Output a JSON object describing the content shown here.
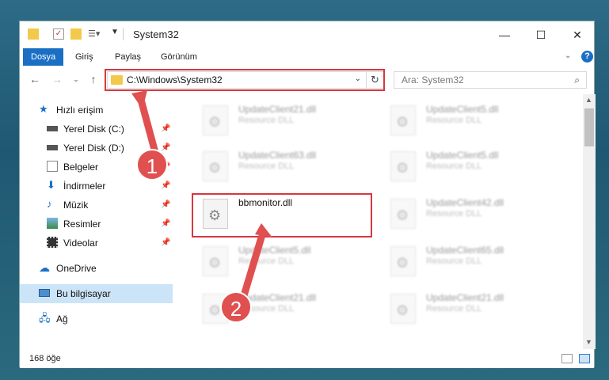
{
  "window": {
    "title": "System32"
  },
  "ribbon": {
    "tabs": [
      "Dosya",
      "Giriş",
      "Paylaş",
      "Görünüm"
    ]
  },
  "address": {
    "path": "C:\\Windows\\System32"
  },
  "search": {
    "placeholder": "Ara: System32"
  },
  "sidebar": {
    "items": [
      {
        "label": "Hızlı erişim"
      },
      {
        "label": "Yerel Disk (C:)"
      },
      {
        "label": "Yerel Disk (D:)"
      },
      {
        "label": "Belgeler"
      },
      {
        "label": "İndirmeler"
      },
      {
        "label": "Müzik"
      },
      {
        "label": "Resimler"
      },
      {
        "label": "Videolar"
      },
      {
        "label": "OneDrive"
      },
      {
        "label": "Bu bilgisayar"
      },
      {
        "label": "Ağ"
      }
    ]
  },
  "files": [
    {
      "name": "UpdateClient21.dll",
      "type": "Resource DLL"
    },
    {
      "name": "UpdateClient5.dll",
      "type": "Resource DLL"
    },
    {
      "name": "UpdateClient63.dll",
      "type": "Resource DLL"
    },
    {
      "name": "UpdateClient5.dll",
      "type": "Resource DLL"
    },
    {
      "name": "bbmonitor.dll",
      "type": ""
    },
    {
      "name": "UpdateClient42.dll",
      "type": "Resource DLL"
    },
    {
      "name": "UpdateClient5.dll",
      "type": "Resource DLL"
    },
    {
      "name": "UpdateClient65.dll",
      "type": "Resource DLL"
    },
    {
      "name": "UpdateClient21.dll",
      "type": "Resource DLL"
    },
    {
      "name": "UpdateClient21.dll",
      "type": "Resource DLL"
    }
  ],
  "status": {
    "count": "168 öğe"
  },
  "callouts": [
    "1",
    "2"
  ],
  "colors": {
    "accent": "#1a6fc4",
    "highlight": "#d7373f",
    "selected": "#cce4f7",
    "folder": "#f3c94b"
  }
}
